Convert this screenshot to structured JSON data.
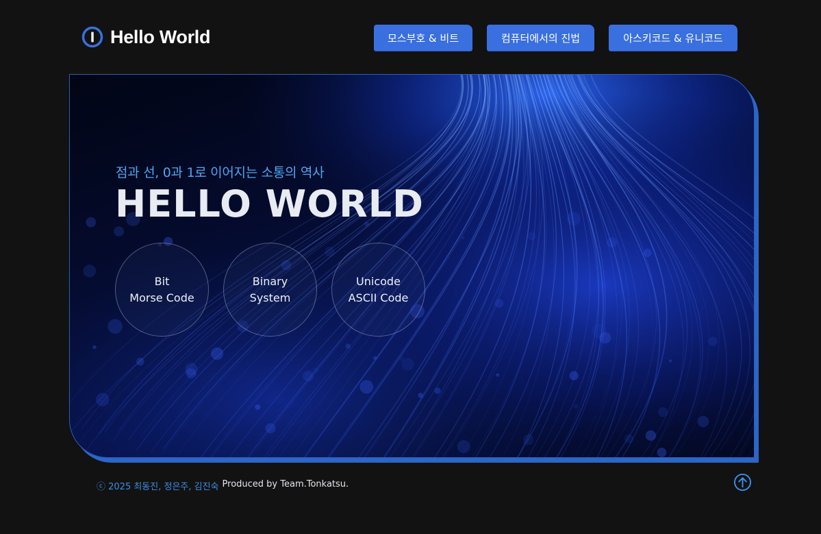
{
  "header": {
    "logo_text": "Hello World",
    "nav": [
      {
        "label": "모스부호 & 비트"
      },
      {
        "label": "컴퓨터에서의 진법"
      },
      {
        "label": "아스키코드 & 유니코드"
      }
    ]
  },
  "hero": {
    "subtitle": "점과 선, 0과 1로 이어지는 소통의 역사",
    "title": "HELLO WORLD",
    "circles": [
      {
        "line1": "Bit",
        "line2": "Morse Code"
      },
      {
        "line1": "Binary",
        "line2": "System"
      },
      {
        "line1": "Unicode",
        "line2": "ASCII Code"
      }
    ]
  },
  "footer": {
    "credits": "ⓒ 2025 최동진, 정은주, 김진숙",
    "produced": "Produced by Team.Tonkatsu."
  },
  "colors": {
    "accent": "#3a6fe0",
    "background": "#121212",
    "subtitle": "#4ea7f0",
    "credits": "#3c8fe6"
  },
  "icons": {
    "logo": "power-icon",
    "scroll_top": "arrow-up-circle-icon"
  }
}
